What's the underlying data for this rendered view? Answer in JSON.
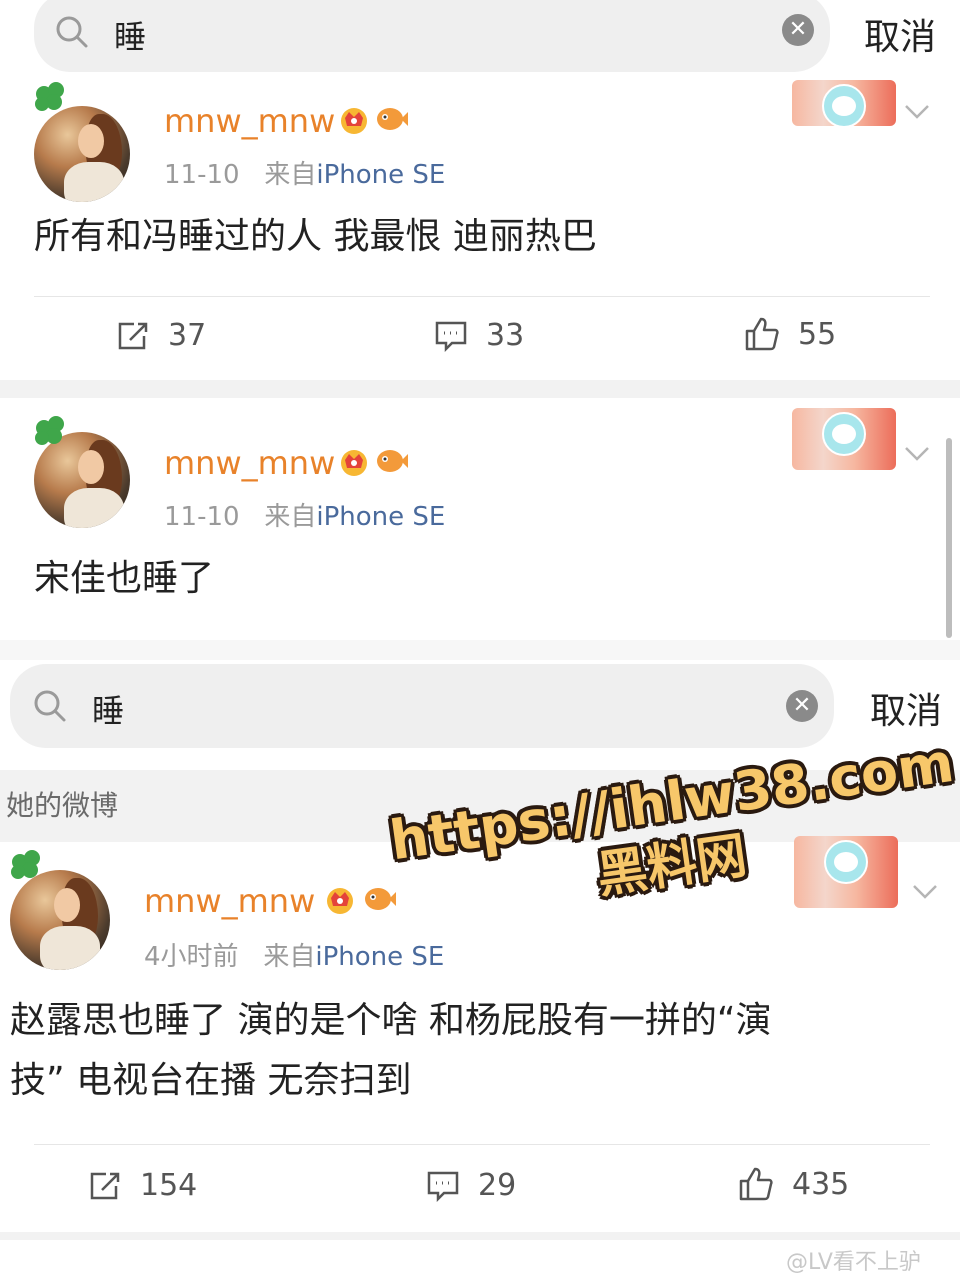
{
  "search_top": {
    "query": "睡",
    "cancel_label": "取消"
  },
  "search_mid": {
    "query": "睡",
    "cancel_label": "取消"
  },
  "posts": [
    {
      "username": "mnw_mnw",
      "date": "11-10",
      "source_prefix": "来自",
      "device": "iPhone SE",
      "text": "所有和冯睡过的人 我最恨 迪丽热巴",
      "reposts": "37",
      "comments": "33",
      "likes": "55"
    },
    {
      "username": "mnw_mnw",
      "date": "11-10",
      "source_prefix": "来自",
      "device": "iPhone SE",
      "text": "宋佳也睡了"
    },
    {
      "username": "mnw_mnw",
      "date": "4小时前",
      "source_prefix": "来自",
      "device": "iPhone SE",
      "text_line1": "赵露思也睡了 演的是个啥 和杨屁股有一拼的“演",
      "text_line2": "技” 电视台在播 无奈扫到",
      "reposts": "154",
      "comments": "29",
      "likes": "435"
    }
  ],
  "section": {
    "label": "她的微博"
  },
  "watermark": {
    "url": "https://ihlw38.com",
    "name": "黑料网"
  },
  "credit": "@LV看不上驴",
  "colors": {
    "username": "#e8822a",
    "device": "#4a6a9c",
    "watermark": "#f7c76a"
  },
  "icons": [
    "search-icon",
    "clear-icon",
    "crown-badge-icon",
    "fish-badge-icon",
    "chevron-down-icon",
    "repost-icon",
    "comment-icon",
    "like-icon",
    "clover-icon"
  ]
}
